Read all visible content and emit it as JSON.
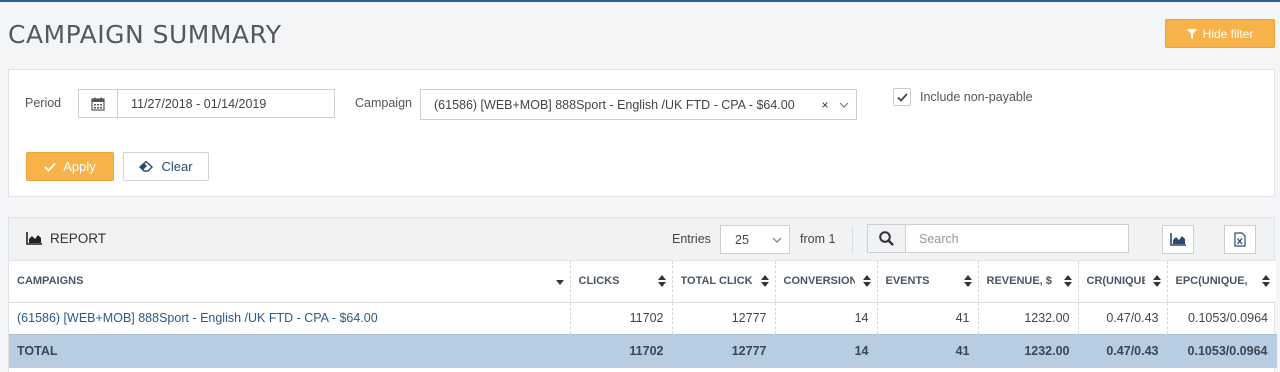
{
  "page": {
    "title": "CAMPAIGN SUMMARY"
  },
  "toolbar": {
    "hide_filter_label": "Hide filter"
  },
  "filter": {
    "period_label": "Period",
    "period_value": "11/27/2018 - 01/14/2019",
    "campaign_label": "Campaign",
    "campaign_value": "(61586) [WEB+MOB] 888Sport - English /UK FTD - CPA - $64.00",
    "clear_x": "×",
    "include_label": "Include non-payable",
    "include_checked": true,
    "apply_label": "Apply",
    "clear_label": "Clear"
  },
  "report": {
    "title": "REPORT",
    "entries_label": "Entries",
    "entries_value": "25",
    "from_label": "from 1",
    "search_placeholder": "Search",
    "columns": [
      "CAMPAIGNS",
      "CLICKS",
      "TOTAL CLICKS",
      "CONVERSION",
      "EVENTS",
      "REVENUE, $",
      "CR(UNIQUE/",
      "EPC(UNIQUE,"
    ],
    "rows": [
      [
        "(61586) [WEB+MOB] 888Sport - English /UK FTD - CPA - $64.00",
        "11702",
        "12777",
        "14",
        "41",
        "1232.00",
        "0.47/0.43",
        "0.1053/0.0964"
      ]
    ],
    "total": [
      "TOTAL",
      "11702",
      "12777",
      "14",
      "41",
      "1232.00",
      "0.47/0.43",
      "0.1053/0.0964"
    ]
  },
  "colors": {
    "accent": "#f8b24a",
    "total_row": "#b8cde1",
    "link": "#2a5a8a"
  }
}
